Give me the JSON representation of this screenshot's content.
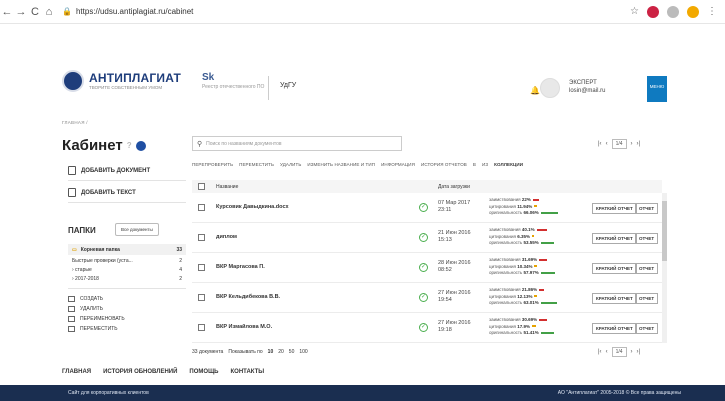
{
  "browser": {
    "url": "https://udsu.antiplagiat.ru/cabinet",
    "back": "←",
    "forward": "→",
    "reload": "C",
    "home": "⌂"
  },
  "header": {
    "logo_main": "АНТИПЛАГИАТ",
    "logo_sub": "ТВОРИТЕ СОБСТВЕННЫМ УМОМ",
    "reestr_sk": "Sk",
    "reestr_text": "Реестр отечественного ПО",
    "university": "УдГУ",
    "user_role": "ЭКСПЕРТ",
    "user_email": "losin@mail.ru",
    "menu_label": "МЕНЮ"
  },
  "breadcrumb": "ГЛАВНАЯ /",
  "sidebar": {
    "title": "Кабинет",
    "add_document": "ДОБАВИТЬ ДОКУМЕНТ",
    "add_text": "ДОБАВИТЬ ТЕКСТ",
    "folders_title": "ПАПКИ",
    "all_docs": "Все документы",
    "root_folder": {
      "name": "Корневая папка",
      "count": "33"
    },
    "folders": [
      {
        "name": "Быстрые проверки (уста...",
        "count": "2"
      },
      {
        "name": "› старые",
        "count": "4"
      },
      {
        "name": "› 2017-2018",
        "count": "2"
      }
    ],
    "actions": [
      "СОЗДАТЬ",
      "УДАЛИТЬ",
      "ПЕРЕИМЕНОВАТЬ",
      "ПЕРЕМЕСТИТЬ"
    ]
  },
  "search": {
    "placeholder": "Поиск по названиям документов"
  },
  "pager": {
    "first": "|‹",
    "prev": "‹",
    "page": "1/4",
    "next": "›",
    "last": "›|"
  },
  "toolbar": [
    "ПЕРЕПРОВЕРИТЬ",
    "ПЕРЕМЕСТИТЬ",
    "УДАЛИТЬ",
    "ИЗМЕНИТЬ НАЗВАНИЕ И ТИП",
    "ИНФОРМАЦИЯ",
    "ИСТОРИЯ ОТЧЕТОВ",
    "В",
    "ИЗ",
    "КОЛЛЕКЦИИ"
  ],
  "table": {
    "col_name": "Название",
    "col_date": "Дата загрузки",
    "short_report": "КРАТКИЙ ОТЧЕТ",
    "report": "ОТЧЕТ",
    "label_borrow": "заимствования",
    "label_cite": "цитирования",
    "label_orig": "оригинальность",
    "rows": [
      {
        "name": "Курсовик Давыдкина.docx",
        "date": "07 Мар 2017",
        "time": "23:11",
        "borrow": "22%",
        "cite": "11.94%",
        "orig": "66.06%"
      },
      {
        "name": "диплом",
        "date": "21 Июн 2016",
        "time": "15:13",
        "borrow": "40.1%",
        "cite": "6.35%",
        "orig": "53.55%"
      },
      {
        "name": "ВКР Маргасова П.",
        "date": "28 Июн 2016",
        "time": "08:52",
        "borrow": "31.69%",
        "cite": "10.34%",
        "orig": "57.97%"
      },
      {
        "name": "ВКР Кельдибекова В.В.",
        "date": "27 Июн 2016",
        "time": "19:54",
        "borrow": "21.86%",
        "cite": "12.13%",
        "orig": "63.01%"
      },
      {
        "name": "ВКР Измайлова М.О.",
        "date": "27 Июн 2016",
        "time": "19:18",
        "borrow": "30.69%",
        "cite": "17.9%",
        "orig": "51.41%"
      }
    ]
  },
  "footer_docs": {
    "count_label": "33 документа",
    "show_label": "Показывать по",
    "options": [
      "10",
      "20",
      "50",
      "100"
    ]
  },
  "bottom_nav": [
    "ГЛАВНАЯ",
    "ИСТОРИЯ ОБНОВЛЕНИЙ",
    "ПОМОЩЬ",
    "КОНТАКТЫ"
  ],
  "footer": {
    "left": "Сайт для корпоративных клиентов",
    "right": "АО \"Антиплагиат\" 2005-2018 © Все права защищены"
  }
}
